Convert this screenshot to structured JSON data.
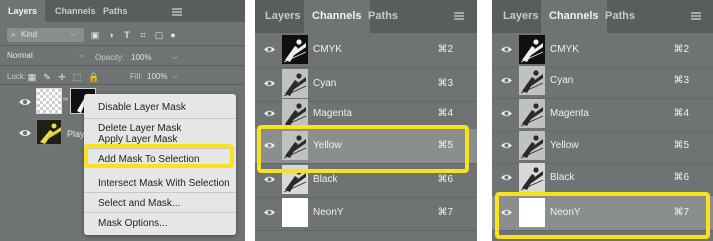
{
  "colors": {
    "highlight": "#f7e21d",
    "panel_bg": "#6f7374",
    "tab_bg": "#5a5d5e",
    "menu_bg": "#e6e6e6"
  },
  "layers_panel": {
    "tabs": [
      "Layers",
      "Channels",
      "Paths"
    ],
    "filter_label": "Kind",
    "blend_mode": "Normal",
    "opacity_label": "Opacity:",
    "opacity_value": "100%",
    "lock_label": "Lock:",
    "fill_label": "Fill:",
    "fill_value": "100%",
    "layers": [
      {
        "name": "",
        "thumbnail": "transparent-with-mask"
      },
      {
        "name": "Playe",
        "thumbnail": "player-image"
      }
    ],
    "context_menu": {
      "items": [
        "Disable Layer Mask",
        "Delete Layer Mask",
        "Apply Layer Mask",
        "Add Mask To Selection",
        "Intersect Mask With Selection",
        "Select and Mask...",
        "Mask Options..."
      ],
      "highlighted_item": "Add Mask To Selection"
    }
  },
  "channels_panel_1": {
    "tabs": [
      "Layers",
      "Channels",
      "Paths"
    ],
    "active_tab": "Channels",
    "channels": [
      {
        "name": "CMYK",
        "shortcut": "⌘2"
      },
      {
        "name": "Cyan",
        "shortcut": "⌘3"
      },
      {
        "name": "Magenta",
        "shortcut": "⌘4"
      },
      {
        "name": "Yellow",
        "shortcut": "⌘5"
      },
      {
        "name": "Black",
        "shortcut": "⌘6"
      },
      {
        "name": "NeonY",
        "shortcut": "⌘7"
      }
    ],
    "highlighted_channel": "Yellow"
  },
  "channels_panel_2": {
    "tabs": [
      "Layers",
      "Channels",
      "Paths"
    ],
    "active_tab": "Channels",
    "channels": [
      {
        "name": "CMYK",
        "shortcut": "⌘2"
      },
      {
        "name": "Cyan",
        "shortcut": "⌘3"
      },
      {
        "name": "Magenta",
        "shortcut": "⌘4"
      },
      {
        "name": "Yellow",
        "shortcut": "⌘5"
      },
      {
        "name": "Black",
        "shortcut": "⌘6"
      },
      {
        "name": "NeonY",
        "shortcut": "⌘7"
      }
    ],
    "highlighted_channel": "NeonY"
  }
}
